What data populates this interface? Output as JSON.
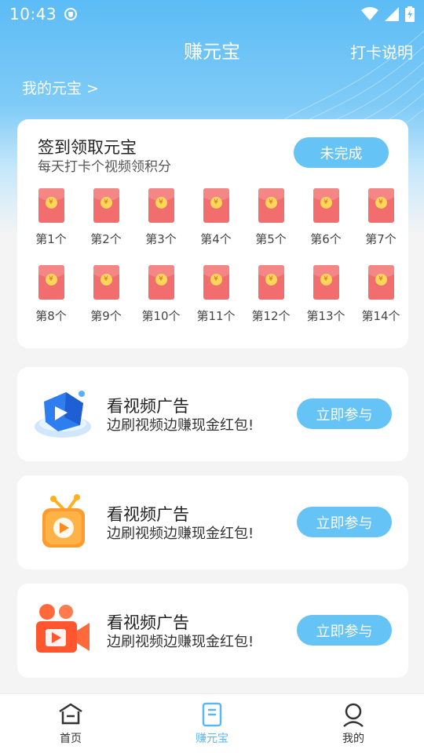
{
  "status_bar": {
    "time": "10:43"
  },
  "header": {
    "title": "赚元宝",
    "rules_link": "打卡说明",
    "my_yuanbao": "我的元宝 >"
  },
  "signin": {
    "title": "签到领取元宝",
    "subtitle": "每天打卡个视频领积分",
    "status_button": "未完成",
    "days": [
      {
        "label": "第1个"
      },
      {
        "label": "第2个"
      },
      {
        "label": "第3个"
      },
      {
        "label": "第4个"
      },
      {
        "label": "第5个"
      },
      {
        "label": "第6个"
      },
      {
        "label": "第7个"
      },
      {
        "label": "第8个"
      },
      {
        "label": "第9个"
      },
      {
        "label": "第10个"
      },
      {
        "label": "第11个"
      },
      {
        "label": "第12个"
      },
      {
        "label": "第13个"
      },
      {
        "label": "第14个"
      }
    ],
    "coin_symbol": "¥"
  },
  "tasks": [
    {
      "title": "看视频广告",
      "desc": "边刷视频边赚现金红包!",
      "button": "立即参与",
      "icon": "play-cube-icon"
    },
    {
      "title": "看视频广告",
      "desc": "边刷视频边赚现金红包!",
      "button": "立即参与",
      "icon": "tv-play-icon"
    },
    {
      "title": "看视频广告",
      "desc": "边刷视频边赚现金红包!",
      "button": "立即参与",
      "icon": "video-camera-icon"
    }
  ],
  "bottom_nav": [
    {
      "label": "首页",
      "icon": "home-icon",
      "active": false
    },
    {
      "label": "赚元宝",
      "icon": "document-icon",
      "active": true
    },
    {
      "label": "我的",
      "icon": "user-icon",
      "active": false
    }
  ],
  "colors": {
    "accent": "#66c3f5",
    "envelope": "#f26d6d",
    "coin": "#ffd55a"
  }
}
